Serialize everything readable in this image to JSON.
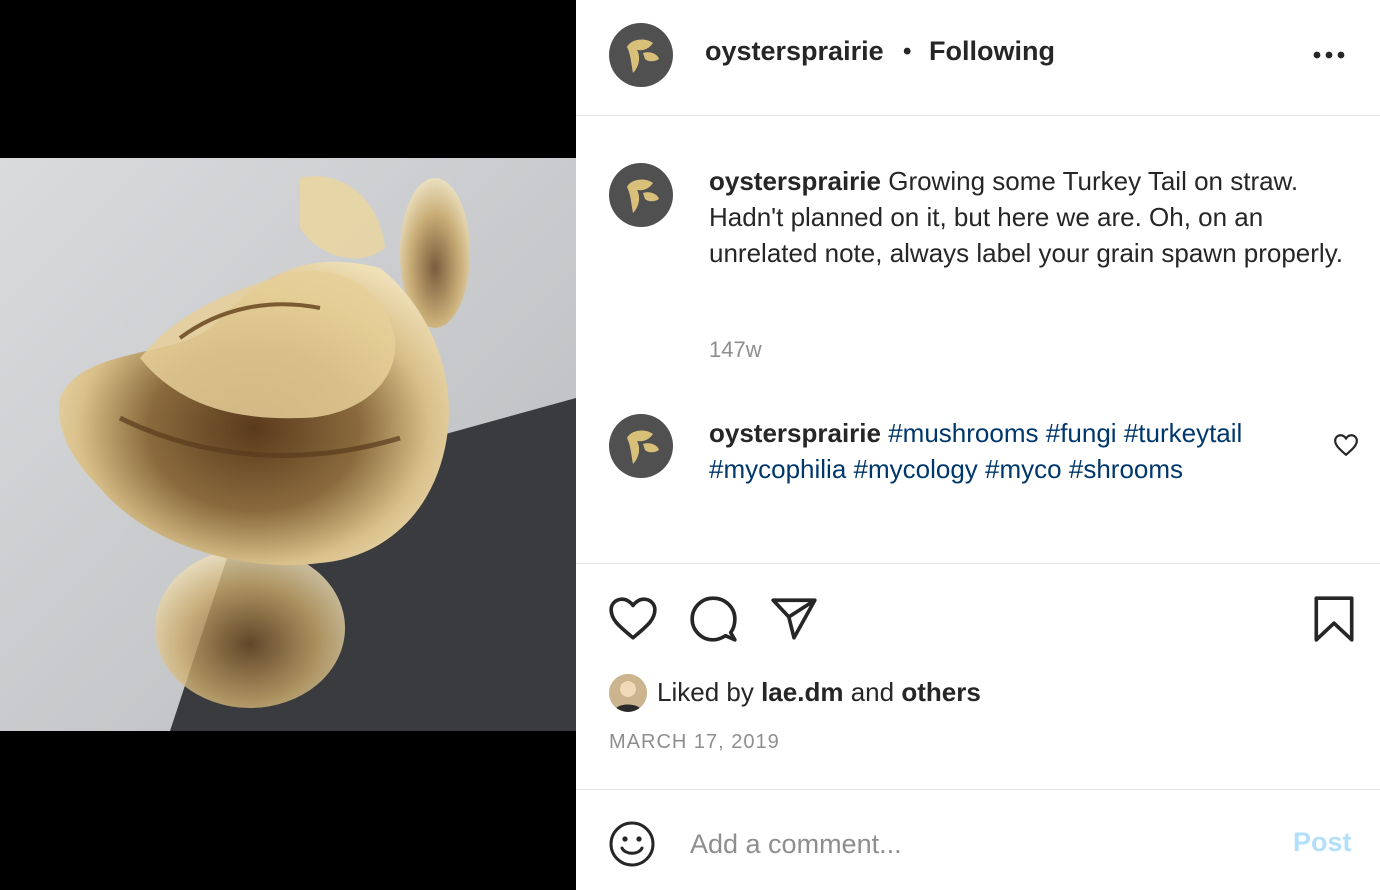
{
  "post": {
    "username": "oystersprairie",
    "separator": "•",
    "follow_status": "Following",
    "caption_text": "Growing some Turkey Tail on straw. Hadn't planned on it, but here we are. Oh, on an unrelated note, always label your grain spawn properly.",
    "caption_time": "147w",
    "hashtags": [
      "#mushrooms",
      "#fungi",
      "#turkeytail",
      "#mycophilia",
      "#mycology",
      "#myco",
      "#shrooms"
    ],
    "likes_prefix": "Liked by",
    "likes_user": "lae.dm",
    "likes_and": "and",
    "likes_others": "others",
    "date": "MARCH 17, 2019",
    "comment_placeholder": "Add a comment...",
    "post_label": "Post"
  },
  "colors": {
    "hashtag": "#00376b",
    "post_button_disabled": "#b2dffc",
    "muted_text": "#8e8e8e",
    "avatar_bg": "#505050",
    "avatar_logo": "#d9c07a"
  },
  "icons": [
    "more-options-icon",
    "heart-icon",
    "comment-icon",
    "share-icon",
    "bookmark-icon",
    "emoji-icon"
  ]
}
